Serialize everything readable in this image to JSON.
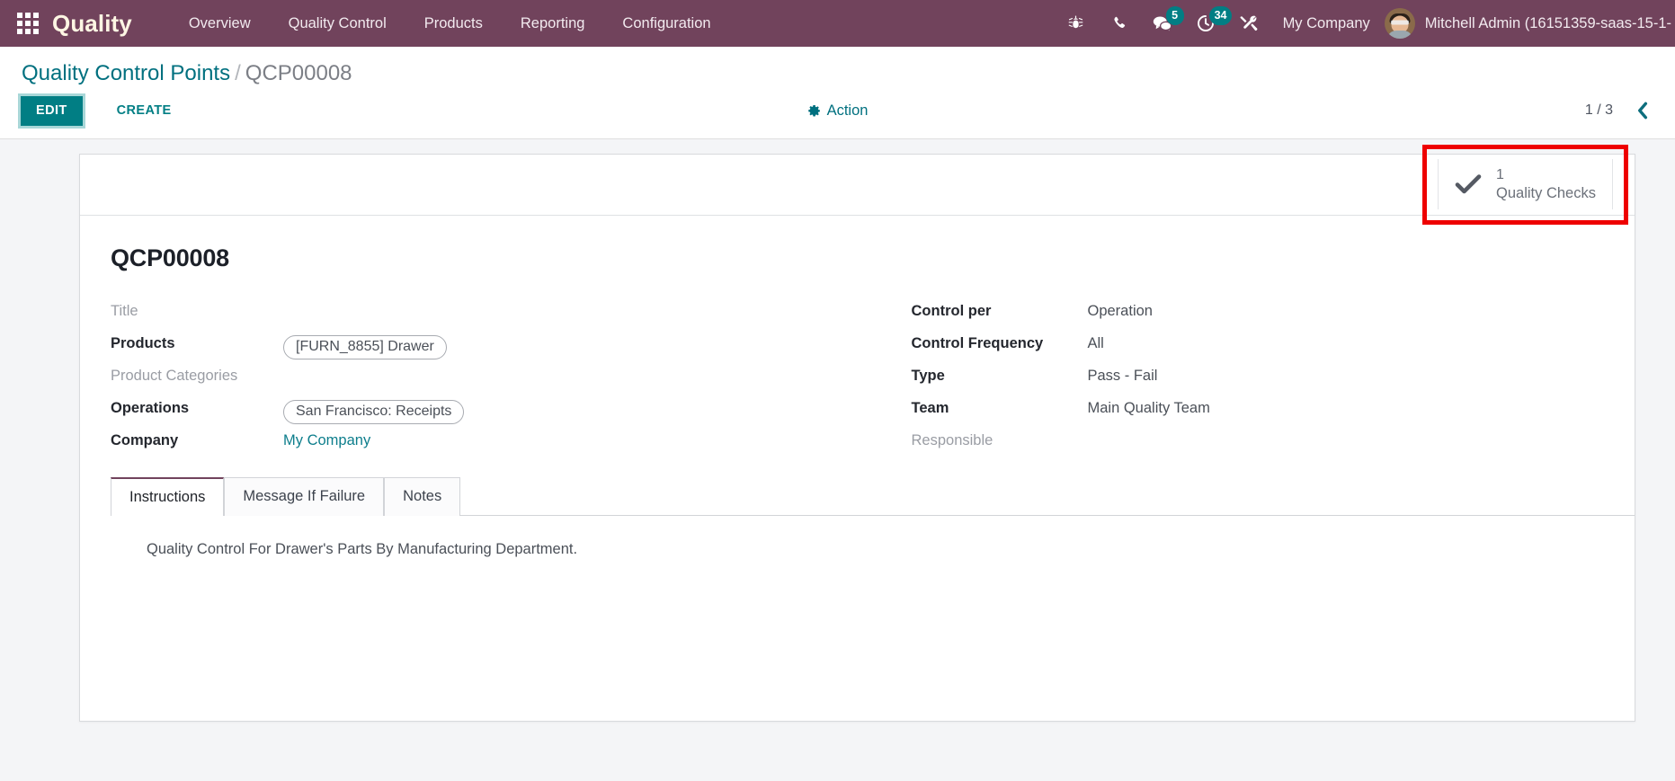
{
  "navbar": {
    "apps_icon": "apps-grid-icon",
    "brand": "Quality",
    "menu": [
      {
        "label": "Overview"
      },
      {
        "label": "Quality Control"
      },
      {
        "label": "Products"
      },
      {
        "label": "Reporting"
      },
      {
        "label": "Configuration"
      }
    ],
    "icons": [
      {
        "name": "bug-icon",
        "badge": ""
      },
      {
        "name": "phone-icon",
        "badge": ""
      },
      {
        "name": "messages-icon",
        "badge": "5"
      },
      {
        "name": "activities-clock-icon",
        "badge": "34"
      },
      {
        "name": "tools-icon",
        "badge": ""
      }
    ],
    "company": "My Company",
    "user_name": "Mitchell Admin (16151359-saas-15-1-",
    "avatar": "user-avatar"
  },
  "control_panel": {
    "breadcrumb": {
      "root": "Quality Control Points",
      "separator": "/",
      "current": "QCP00008"
    },
    "edit_label": "EDIT",
    "create_label": "CREATE",
    "action_label": "Action",
    "action_icon": "gear-icon",
    "pager_value": "1 / 3",
    "pager_prev_icon": "chevron-left-icon"
  },
  "sheet": {
    "stat_button": {
      "icon": "check-icon",
      "count": "1",
      "label": "Quality Checks",
      "highlight_color": "#ee0000"
    },
    "record_title": "QCP00008",
    "left_fields": [
      {
        "label": "Title",
        "value": "",
        "kind": "empty"
      },
      {
        "label": "Products",
        "value": "[FURN_8855] Drawer",
        "kind": "tag"
      },
      {
        "label": "Product Categories",
        "value": "",
        "kind": "empty"
      },
      {
        "label": "Operations",
        "value": "San Francisco: Receipts",
        "kind": "tag"
      },
      {
        "label": "Company",
        "value": "My Company",
        "kind": "link"
      }
    ],
    "right_fields": [
      {
        "label": "Control per",
        "value": "Operation",
        "kind": "text"
      },
      {
        "label": "Control Frequency",
        "value": "All",
        "kind": "text"
      },
      {
        "label": "Type",
        "value": "Pass - Fail",
        "kind": "text"
      },
      {
        "label": "Team",
        "value": "Main Quality Team",
        "kind": "text"
      },
      {
        "label": "Responsible",
        "value": "",
        "kind": "empty"
      }
    ],
    "tabs": [
      {
        "label": "Instructions",
        "active": true
      },
      {
        "label": "Message If Failure",
        "active": false
      },
      {
        "label": "Notes",
        "active": false
      }
    ],
    "instructions_text": "Quality Control For Drawer's Parts By Manufacturing Department."
  },
  "colors": {
    "navbar": "#71435c",
    "accent_teal": "#017e84",
    "link_teal": "#00707f",
    "highlight_red": "#ee0000",
    "active_tab_border": "#71435c"
  }
}
